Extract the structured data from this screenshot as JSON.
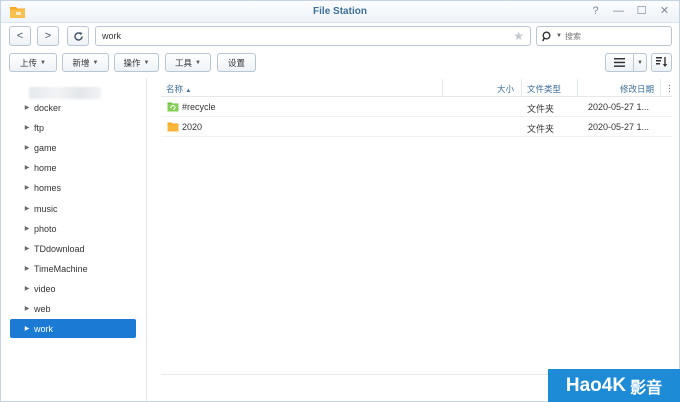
{
  "window": {
    "title": "File Station"
  },
  "title_buttons": {
    "help": "?",
    "minimize": "—",
    "maximize": "☐",
    "close": "✕"
  },
  "nav": {
    "back": "<",
    "forward": ">",
    "refresh": "C",
    "path": "work",
    "search_placeholder": "搜索"
  },
  "toolbar": {
    "upload": "上传",
    "create": "新增",
    "action": "操作",
    "tools": "工具",
    "settings": "设置"
  },
  "sidebar": {
    "items": [
      {
        "label": "docker"
      },
      {
        "label": "ftp"
      },
      {
        "label": "game"
      },
      {
        "label": "home"
      },
      {
        "label": "homes"
      },
      {
        "label": "music"
      },
      {
        "label": "photo"
      },
      {
        "label": "TDdownload"
      },
      {
        "label": "TimeMachine"
      },
      {
        "label": "video"
      },
      {
        "label": "web"
      },
      {
        "label": "work",
        "selected": true
      }
    ]
  },
  "table": {
    "headers": {
      "name": "名称",
      "size": "大小",
      "type": "文件类型",
      "modified": "修改日期"
    },
    "rows": [
      {
        "name": "#recycle",
        "size": "",
        "type": "文件夹",
        "modified": "2020-05-27 1...",
        "icon": "recycle-folder-icon"
      },
      {
        "name": "2020",
        "size": "",
        "type": "文件夹",
        "modified": "2020-05-27 1...",
        "icon": "folder-icon"
      }
    ]
  },
  "watermark": {
    "text": "Hao4K",
    "suffix": "影音"
  },
  "colors": {
    "accent": "#1a7ad4",
    "title": "#3b6e9b",
    "folder": "#f5a623",
    "recycle": "#6bbf3a",
    "watermark": "#1e8bd6"
  }
}
